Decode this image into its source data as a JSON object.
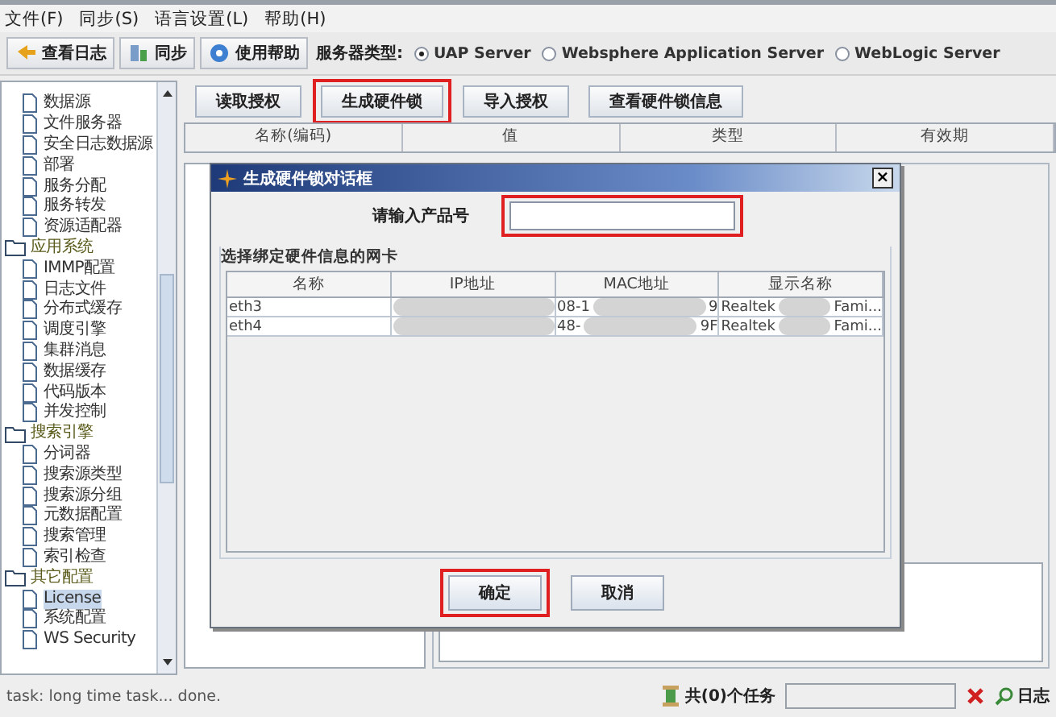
{
  "menu": [
    "文件(F)",
    "同步(S)",
    "语言设置(L)",
    "帮助(H)"
  ],
  "toolbar": {
    "buttons": [
      "查看日志",
      "同步",
      "使用帮助"
    ],
    "server_label": "服务器类型:",
    "servers": [
      {
        "label": "UAP Server",
        "selected": true
      },
      {
        "label": "Websphere Application Server",
        "selected": false
      },
      {
        "label": "WebLogic Server",
        "selected": false
      }
    ]
  },
  "tree": [
    {
      "label": "数据源",
      "selected": false
    },
    {
      "label": "文件服务器",
      "selected": false
    },
    {
      "label": "安全日志数据源",
      "selected": false
    },
    {
      "label": "部署",
      "selected": false
    },
    {
      "label": "服务分配",
      "selected": false
    },
    {
      "label": "服务转发",
      "selected": false
    },
    {
      "label": "资源适配器",
      "selected": false
    },
    {
      "label": "应用系统",
      "selected": false,
      "children": [
        {
          "label": "IMMP配置",
          "selected": false
        },
        {
          "label": "日志文件",
          "selected": false
        },
        {
          "label": "分布式缓存",
          "selected": false
        },
        {
          "label": "调度引擎",
          "selected": false
        },
        {
          "label": "集群消息",
          "selected": false
        },
        {
          "label": "数据缓存",
          "selected": false
        },
        {
          "label": "代码版本",
          "selected": false
        },
        {
          "label": "并发控制",
          "selected": false
        }
      ]
    },
    {
      "label": "搜索引擎",
      "selected": false,
      "children": [
        {
          "label": "分词器",
          "selected": false
        },
        {
          "label": "搜索源类型",
          "selected": false
        },
        {
          "label": "搜索源分组",
          "selected": false
        },
        {
          "label": "元数据配置",
          "selected": false
        },
        {
          "label": "搜索管理",
          "selected": false
        },
        {
          "label": "索引检查",
          "selected": false
        }
      ]
    },
    {
      "label": "其它配置",
      "selected": false,
      "children": [
        {
          "label": "License",
          "selected": true
        },
        {
          "label": "系统配置",
          "selected": false
        },
        {
          "label": "WS Security",
          "selected": false
        }
      ]
    }
  ],
  "actions": [
    {
      "label": "读取授权",
      "highlighted": false
    },
    {
      "label": "生成硬件锁",
      "highlighted": true
    },
    {
      "label": "导入授权",
      "highlighted": false
    },
    {
      "label": "查看硬件锁信息",
      "highlighted": false
    }
  ],
  "table": {
    "columns": [
      "名称(编码)",
      "值",
      "类型",
      "有效期"
    ]
  },
  "dialog": {
    "title": "生成硬件锁对话框",
    "close": "×",
    "product_label": "请输入产品号",
    "product_field": {
      "highlighted": true
    },
    "group_title": "选择绑定硬件信息的网卡",
    "columns": [
      "名称",
      "IP地址",
      "MAC地址",
      "显示名称"
    ],
    "rows": [
      {
        "name": "eth3",
        "ip": {
          "blurred": true
        },
        "mac": {
          "blurred": true,
          "start": "08-1",
          "end": "9"
        },
        "display": {
          "blurred": true,
          "start": "Realtek",
          "end": "Fami..."
        }
      },
      {
        "name": "eth4",
        "ip": {
          "blurred": true
        },
        "mac": {
          "blurred": true,
          "start": "48-",
          "end": "9F"
        },
        "display": {
          "blurred": true,
          "start": "Realtek",
          "end": "Fami..."
        }
      }
    ],
    "buttons": [
      {
        "label": "确定",
        "highlighted": true
      },
      {
        "label": "取消",
        "highlighted": false
      }
    ]
  },
  "status": {
    "message": "task: long time task... done.",
    "tasks": "共(0)个任务",
    "log": "日志"
  }
}
